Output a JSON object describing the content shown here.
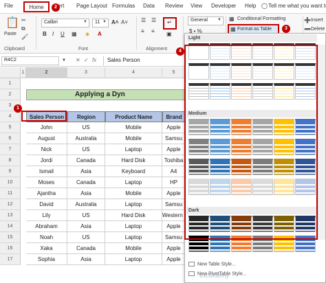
{
  "ribbon": {
    "tabs": [
      "File",
      "Home",
      "ert",
      "Page Layout",
      "Formulas",
      "Data",
      "Review",
      "View",
      "Developer",
      "Help",
      "Tell me what you want to do"
    ],
    "font_name": "Calibri",
    "font_size": "11",
    "number_format": "General",
    "paste_label": "Paste",
    "groups": [
      "Clipboard",
      "Font",
      "Alignment"
    ],
    "conditional_formatting": "Conditional Formatting",
    "format_as_table": "Format as Table",
    "insert": "Insert",
    "delete": "Delete"
  },
  "badges": [
    "1",
    "2",
    "3",
    "4"
  ],
  "formula_bar": {
    "name_box": "R4C2",
    "value": "Sales Person"
  },
  "grid": {
    "column_headers": [
      "1",
      "2",
      "3",
      "4",
      "5"
    ],
    "title": "Applying a Dyn",
    "headers": [
      "Sales Person",
      "Region",
      "Product Name",
      "Brand"
    ],
    "rows": [
      {
        "num": "5",
        "cells": [
          "John",
          "US",
          "Mobile",
          "Apple"
        ]
      },
      {
        "num": "6",
        "cells": [
          "August",
          "Australia",
          "Mobile",
          "Samsu"
        ]
      },
      {
        "num": "7",
        "cells": [
          "Nick",
          "US",
          "Laptop",
          "Apple"
        ]
      },
      {
        "num": "8",
        "cells": [
          "Jordi",
          "Canada",
          "Hard Disk",
          "Toshiba"
        ]
      },
      {
        "num": "9",
        "cells": [
          "Ismail",
          "Asia",
          "Keyboard",
          "A4"
        ]
      },
      {
        "num": "10",
        "cells": [
          "Moses",
          "Canada",
          "Laptop",
          "HP"
        ]
      },
      {
        "num": "11",
        "cells": [
          "Ajantha",
          "Asia",
          "Mobile",
          "Apple"
        ]
      },
      {
        "num": "12",
        "cells": [
          "David",
          "Australia",
          "Laptop",
          "Samsu"
        ]
      },
      {
        "num": "13",
        "cells": [
          "Lily",
          "US",
          "Hard Disk",
          "Western d"
        ]
      },
      {
        "num": "14",
        "cells": [
          "Abraham",
          "Asia",
          "Laptop",
          "Apple"
        ]
      },
      {
        "num": "15",
        "cells": [
          "Noah",
          "US",
          "Laptop",
          "Samsu"
        ]
      },
      {
        "num": "16",
        "cells": [
          "Xaka",
          "Canada",
          "Mobile",
          "Apple"
        ]
      },
      {
        "num": "17",
        "cells": [
          "Sophia",
          "Asia",
          "Laptop",
          "Apple"
        ]
      }
    ],
    "row_nums_top": [
      "1",
      "2",
      "3",
      "4"
    ]
  },
  "gallery": {
    "sections": [
      "Light",
      "Medium",
      "Dark"
    ],
    "new_table_style": "New Table Style...",
    "new_pivot_style": "New PivotTable Style...",
    "colors": {
      "light": [
        [
          "#ffffff",
          "#ddebf7",
          "#fce4d6",
          "#ededed",
          "#fff2cc",
          "#dbe5f1"
        ],
        [
          "#ffffff",
          "#ddebf7",
          "#fce4d6",
          "#ededed",
          "#fff2cc",
          "#deeaf6"
        ],
        [
          "#bfbfbf",
          "#9bc2e6",
          "#f8cbad",
          "#c9c9c9",
          "#ffe699",
          "#b4c6e7"
        ]
      ],
      "medium": [
        [
          "#a6a6a6",
          "#5b9bd5",
          "#ed7d31",
          "#a5a5a5",
          "#ffc000",
          "#4472c4"
        ],
        [
          "#808080",
          "#5b9bd5",
          "#ed7d31",
          "#a5a5a5",
          "#ffc000",
          "#4472c4"
        ],
        [
          "#595959",
          "#2f75b5",
          "#c65911",
          "#7b7b7b",
          "#bf8f00",
          "#305496"
        ],
        [
          "#d9d9d9",
          "#bdd7ee",
          "#f8cbad",
          "#dbdbdb",
          "#ffe699",
          "#b4c6e7"
        ]
      ],
      "dark": [
        [
          "#262626",
          "#1f4e78",
          "#843c0c",
          "#3a3a3a",
          "#7f6000",
          "#203764"
        ],
        [
          "#000000",
          "#2f75b5",
          "#ed7d31",
          "#7b7b7b",
          "#ffc000",
          "#4472c4"
        ]
      ]
    },
    "watermark": "exceldemy"
  }
}
